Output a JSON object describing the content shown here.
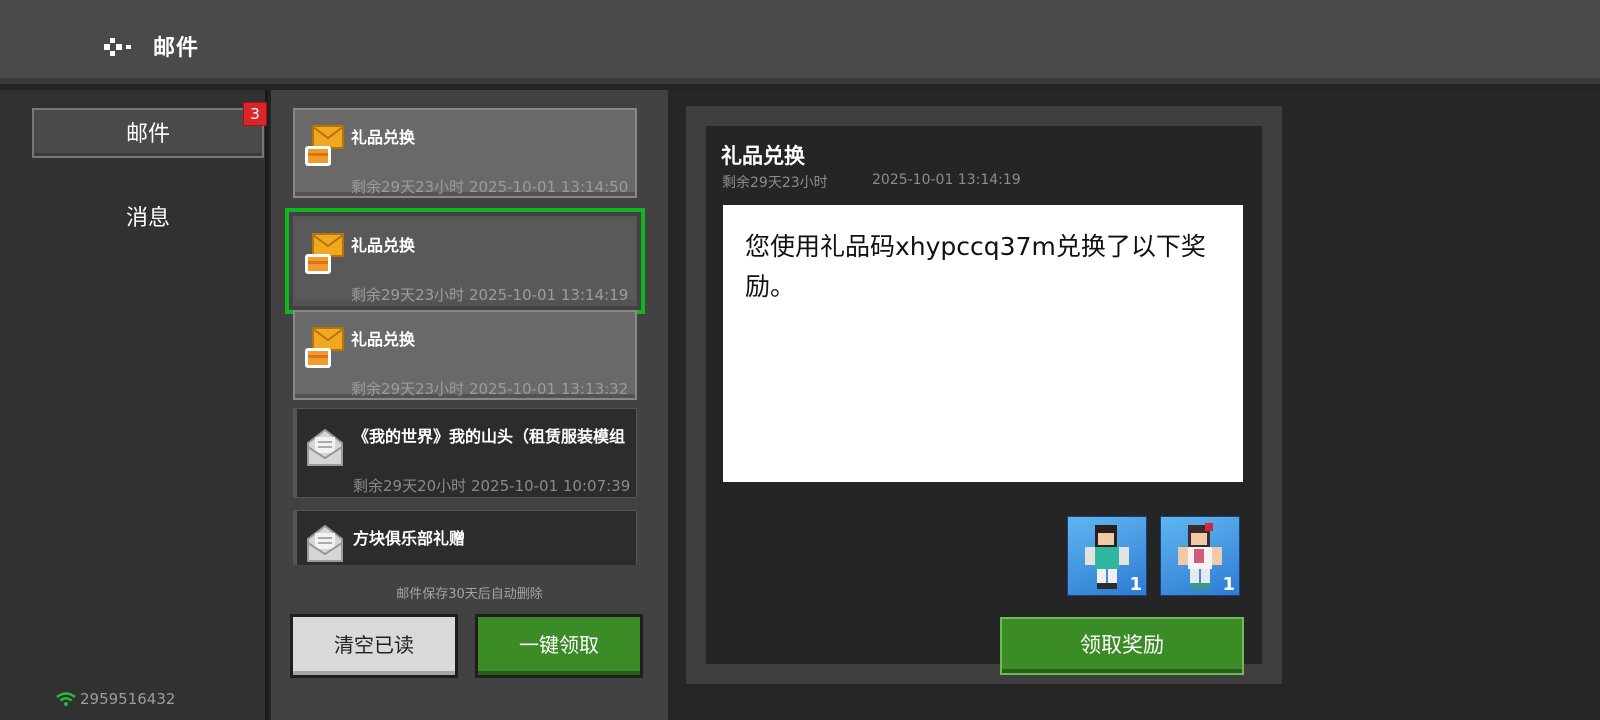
{
  "header": {
    "title": "邮件"
  },
  "sidebar": {
    "items": [
      {
        "label": "邮件",
        "badge": "3",
        "active": true
      },
      {
        "label": "消息",
        "active": false
      }
    ],
    "user_id": "2959516432"
  },
  "mail_list": {
    "items": [
      {
        "name": "礼品兑换",
        "time": "剩余29天23小时 2025-10-01 13:14:50",
        "icon": "gift-mail-icon",
        "selected": false
      },
      {
        "name": "礼品兑换",
        "time": "剩余29天23小时 2025-10-01 13:14:19",
        "icon": "gift-mail-icon",
        "selected": true
      },
      {
        "name": "礼品兑换",
        "time": "剩余29天23小时 2025-10-01 13:13:32",
        "icon": "gift-mail-icon",
        "selected": false
      },
      {
        "name": "《我的世界》我的山头（租赁服装模组",
        "time": "剩余29天20小时 2025-10-01 10:07:39",
        "icon": "open-envelope-icon",
        "selected": false
      },
      {
        "name": "方块俱乐部礼赠",
        "time": "",
        "icon": "open-envelope-icon",
        "selected": false
      }
    ],
    "note": "邮件保存30天后自动删除",
    "clear_read_label": "清空已读",
    "claim_all_label": "一键领取"
  },
  "detail": {
    "title": "礼品兑换",
    "remaining": "剩余29天23小时",
    "date": "2025-10-01 13:14:19",
    "body": "您使用礼品码xhypccq37m兑换了以下奖励。",
    "rewards": [
      {
        "name": "skin-reward-1",
        "count": "1"
      },
      {
        "name": "skin-reward-2",
        "count": "1"
      }
    ],
    "claim_label": "领取奖励"
  },
  "colors": {
    "accent_green": "#3b8b27",
    "selection_outline": "#11b51f",
    "badge_red": "#d9262b"
  }
}
